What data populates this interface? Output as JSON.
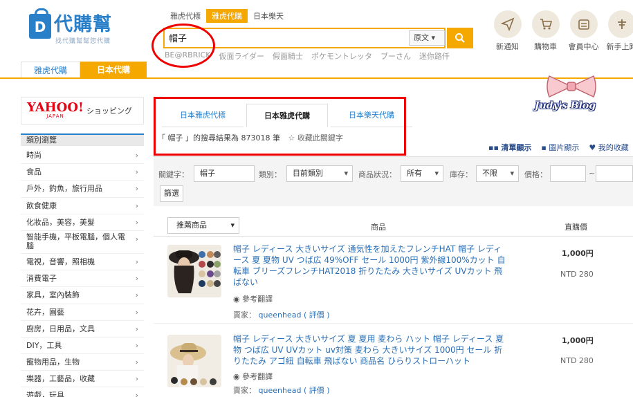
{
  "header": {
    "logo_title": "代購幫",
    "logo_subtitle": "找代購幫幫您代購",
    "site_tabs": [
      "雅虎代購",
      "日本代購"
    ],
    "search_tabs": [
      "雅虎代標",
      "雅虎代購",
      "日本樂天"
    ],
    "search_value": "帽子",
    "lang_option": "原文",
    "hot_words": [
      "BE@RBRICK",
      "仮面ライダー",
      "假面騎士",
      "ポケモントレッタ",
      "ブーさん",
      "迷你路仟"
    ],
    "top_icons": [
      {
        "label": "新通知",
        "icon": "paper-plane-icon"
      },
      {
        "label": "購物車",
        "icon": "cart-icon"
      },
      {
        "label": "會員中心",
        "icon": "member-card-icon"
      },
      {
        "label": "新手上路",
        "icon": "beginner-icon"
      }
    ]
  },
  "watermark": "Judy's Blog",
  "sidebar": {
    "yahoo_word": "YAHOO!",
    "yahoo_japan": "JAPAN",
    "yahoo_shopping": "ショッピング",
    "category_header": "類別瀏覽",
    "categories": [
      "時尚",
      "食品",
      "戶外，釣魚，旅行用品",
      "飲食健康",
      "化妝品，美容，美髮",
      "智能手機，平板電腦，個人電腦",
      "電視，音響，照相機",
      "消費電子",
      "家具，室內裝飾",
      "花卉，園藝",
      "廚房，日用品，文具",
      "DIY，工具",
      "寵物用品，生物",
      "樂器，工藝品，收藏",
      "遊戲，玩具"
    ]
  },
  "main": {
    "service_tabs": [
      "日本雅虎代標",
      "日本雅虎代購",
      "日本樂天代購"
    ],
    "result_text": "「 帽子 」的搜尋結果為 873018 筆",
    "favorite_text": "收藏此關鍵字",
    "view_list": "清單顯示",
    "view_image": "圖片顯示",
    "my_favorites": "我的收藏",
    "filters": {
      "keyword_label": "關鍵字：",
      "keyword_value": "帽子",
      "category_label": "類別：",
      "category_value": "目前類別",
      "condition_label": "商品狀況：",
      "condition_value": "所有",
      "stock_label": "庫存：",
      "stock_value": "不限",
      "price_label": "價格：",
      "price_sep": "~",
      "button": "篩選"
    },
    "list_header": {
      "sort": "推薦商品",
      "product": "商品",
      "price": "直購價"
    },
    "products": [
      {
        "title": "帽子 レディース 大きいサイズ 通気性を加えたフレンチHAT 帽子 レディース 夏 夏物 UV つば広 49%OFF セール 1000円 紫外線100%カット 自転車 ブリーズフレンチHAT2018 折りたたみ 大きいサイズ UVカット 飛ばない",
        "ref": "參考翻譯",
        "seller_label": "賣家：",
        "seller": "queenhead",
        "rating": "( 評價 )",
        "price_yen": "1,000円",
        "price_ntd": "NTD 280"
      },
      {
        "title": "帽子 レディース 大きいサイズ 夏 夏用 麦わら ハット 帽子 レディース 夏物 つば広 UV UVカット uv対策 麦わら 大きいサイズ 1000円 セール 折りたたみ アゴ紐 自転車 飛ばない 商品名 ひらりストローハット",
        "ref": "參考翻譯",
        "seller_label": "賣家：",
        "seller": "queenhead",
        "rating": "( 評價 )",
        "price_yen": "1,000円",
        "price_ntd": "NTD 280"
      }
    ]
  },
  "colors": {
    "accent": "#f5a800",
    "brand_blue": "#2a7fc9",
    "annotation_red": "#e00000"
  }
}
